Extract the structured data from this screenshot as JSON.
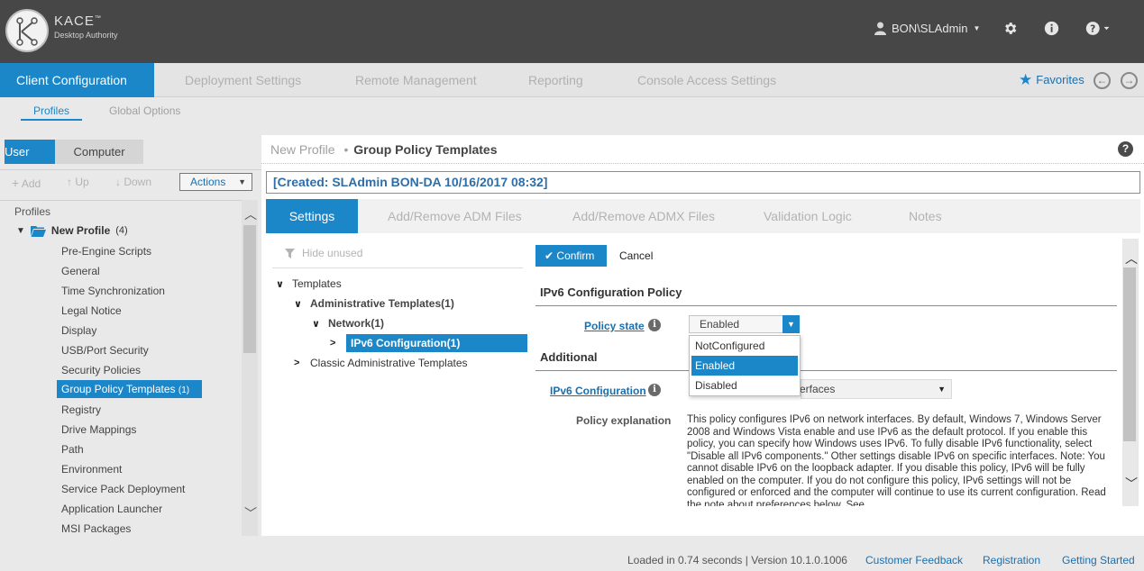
{
  "header": {
    "brand_name": "KACE",
    "brand_mark": "™",
    "brand_sub": "Desktop Authority",
    "user": "BON\\SLAdmin",
    "icons": [
      "user-icon",
      "gear-icon",
      "info-icon",
      "help-icon"
    ]
  },
  "main_nav": {
    "tabs": [
      "Client Configuration",
      "Deployment Settings",
      "Remote Management",
      "Reporting",
      "Console Access Settings"
    ],
    "favorites": "Favorites"
  },
  "sub_nav": {
    "items": [
      "Profiles",
      "Global Options"
    ]
  },
  "left": {
    "tabs": [
      "User",
      "Computer"
    ],
    "toolbar": {
      "add": "Add",
      "up": "Up",
      "down": "Down",
      "actions": "Actions"
    },
    "profiles_label": "Profiles",
    "root": {
      "label": "New Profile",
      "count": "(4)"
    },
    "items": [
      "Pre-Engine Scripts",
      "General",
      "Time Synchronization",
      "Legal Notice",
      "Display",
      "USB/Port Security",
      "Security Policies",
      "Group Policy Templates",
      "Registry",
      "Drive Mappings",
      "Path",
      "Environment",
      "Service Pack Deployment",
      "Application Launcher",
      "MSI Packages"
    ],
    "selected_count": "(1)"
  },
  "right": {
    "crumb": "New Profile",
    "crumb_sep": "•",
    "title": "Group Policy Templates",
    "created": "[Created: SLAdmin BON-DA 10/16/2017 08:32]",
    "tabs": [
      "Settings",
      "Add/Remove ADM Files",
      "Add/Remove ADMX Files",
      "Validation Logic",
      "Notes"
    ],
    "hide_unused": "Hide unused",
    "tree": {
      "templates": "Templates",
      "admin": "Administrative Templates(1)",
      "network": "Network(1)",
      "ipv6": "IPv6 Configuration(1)",
      "classic": "Classic Administrative Templates"
    },
    "confirm": "Confirm",
    "cancel": "Cancel",
    "policy_title": "IPv6 Configuration Policy",
    "policy_state_label": "Policy state",
    "policy_state_value": "Enabled",
    "policy_state_options": [
      "NotConfigured",
      "Enabled",
      "Disabled"
    ],
    "additional": "Additional",
    "ipv6_label": "IPv6 Configuration",
    "ipv6_value_partial": "erfaces",
    "explanation_label": "Policy explanation",
    "explanation": "This policy configures IPv6 on network interfaces. By default, Windows 7, Windows Server 2008 and Windows Vista enable and use IPv6 as the default protocol. If you enable this policy, you can specify how Windows uses IPv6. To fully disable IPv6 functionality, select \"Disable all IPv6 components.\" Other settings disable IPv6 on specific interfaces. Note: You cannot disable IPv6 on the loopback adapter. If you disable this policy, IPv6 will be fully enabled on the computer. If you do not configure this policy, IPv6 settings will not be configured or enforced and the computer will continue to use its current configuration. Read the note about preferences below. See"
  },
  "footer": {
    "loaded": "Loaded in 0.74 seconds | Version 10.1.0.1006",
    "links": [
      "Customer Feedback",
      "Registration",
      "Getting Started"
    ]
  },
  "colors": {
    "accent": "#1b87c9",
    "header_bg": "#474747",
    "link": "#1b6fad"
  }
}
